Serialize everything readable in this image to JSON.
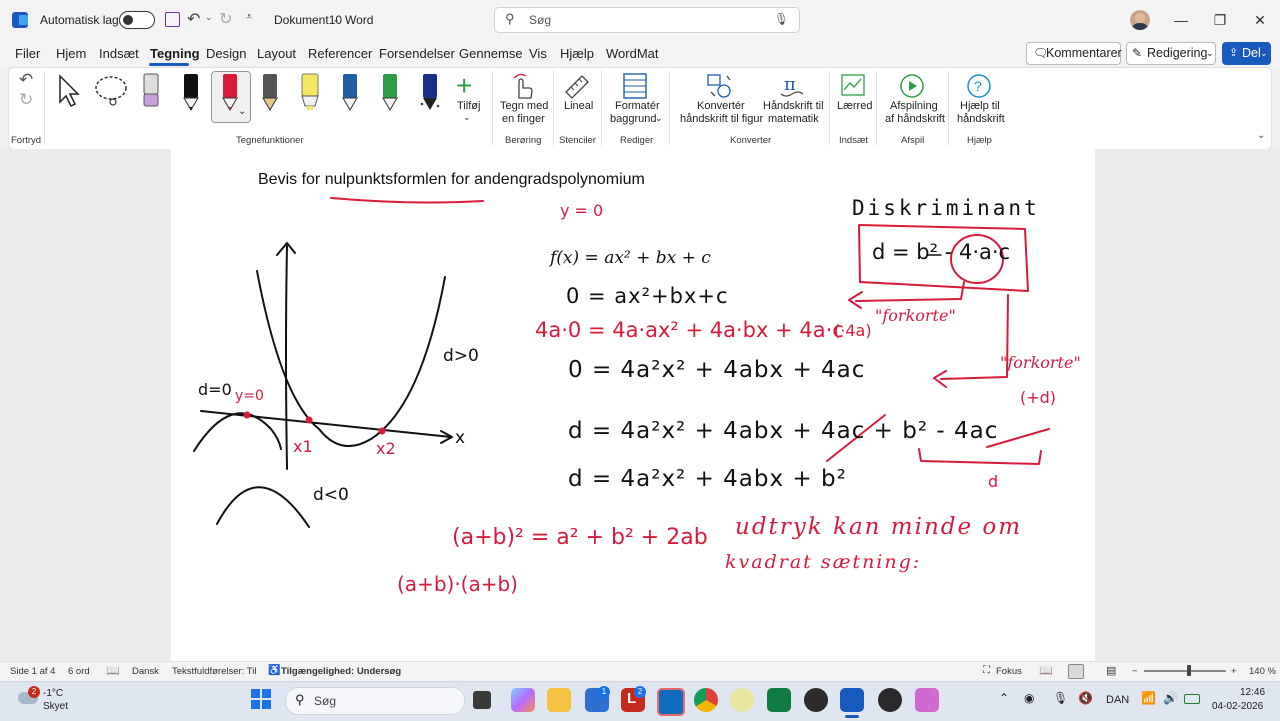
{
  "titlebar": {
    "autosave_label": "Automatisk lagring",
    "document_title": "Dokument10",
    "separator": "-",
    "app_name": "Word",
    "search_placeholder": "Søg"
  },
  "menu": {
    "tabs": [
      {
        "label": "Filer"
      },
      {
        "label": "Hjem"
      },
      {
        "label": "Indsæt"
      },
      {
        "label": "Tegning"
      },
      {
        "label": "Design"
      },
      {
        "label": "Layout"
      },
      {
        "label": "Referencer"
      },
      {
        "label": "Forsendelser"
      },
      {
        "label": "Gennemse"
      },
      {
        "label": "Vis"
      },
      {
        "label": "Hjælp"
      },
      {
        "label": "WordMat"
      }
    ],
    "active_tab": "Tegning",
    "comments_label": "Kommentarer",
    "editing_label": "Redigering",
    "share_label": "Del"
  },
  "ribbon": {
    "groups": {
      "undo": "Fortryd",
      "draw_tools": "Tegnefunktioner",
      "touch": "Berøring",
      "stencils": "Stenciler",
      "edit": "Rediger",
      "convert": "Konverter",
      "insert": "Indsæt",
      "replay": "Afspil",
      "help": "Hjælp"
    },
    "add_label": "Tilføj",
    "draw_finger": [
      "Tegn med",
      "en finger"
    ],
    "ruler": "Lineal",
    "format_bg": [
      "Formatér",
      "baggrund"
    ],
    "ink_to_shape": [
      "Konvertér",
      "håndskrift til figur"
    ],
    "ink_to_math": [
      "Håndskrift til",
      "matematik"
    ],
    "canvas": "Lærred",
    "ink_replay": [
      "Afspilning",
      "af håndskrift"
    ],
    "ink_help": [
      "Hjælp til",
      "håndskrift"
    ],
    "pen_colors": [
      "#111111",
      "#d81b3a",
      "#555555",
      "#f5e663",
      "#1f5fa8",
      "#2e9e46",
      "#1a2f8a"
    ]
  },
  "document": {
    "heading_prefix": "Bevis for ",
    "heading_underlined": "nulpunktsformlen",
    "heading_suffix": " for andengradspolynomium",
    "typed_formula": "f(x) = ax² + bx + c",
    "ink_black": {
      "eq1": "0 = ax²+bx+c",
      "eq2": "0 = 4a²x² + 4abx + 4ac",
      "eq3": "d = 4a²x² + 4abx + 4ac + b² - 4ac",
      "eq4": "d = 4a²x² + 4abx + b²",
      "discriminant_title": "Diskriminant",
      "discriminant_formula": "d = b² - 4·a·c",
      "graph_d_pos": "d>0",
      "graph_d_zero": "d=0",
      "graph_d_neg": "d<0",
      "axis_x": "x"
    },
    "ink_red": {
      "y0": "y = 0",
      "mult_line": "4a·0 = 4a·ax² + 4a·bx + 4a·c",
      "times4a": "(·4a)",
      "forkorte1": "\"forkorte\"",
      "forkorte2": "\"forkorte\"",
      "plus_d": "(+d)",
      "d_label": "d",
      "y0_graph": "y=0",
      "x1": "x1",
      "x2": "x2",
      "square": "(a+b)² = a² + b² + 2ab",
      "product": "(a+b)·(a+b)",
      "note1": "udtryk kan minde om",
      "note2": "kvadrat sætning:"
    }
  },
  "status": {
    "page": "Side 1 af 4",
    "words": "6 ord",
    "language": "Dansk",
    "predictions": "Tekstfuldførelser: Til",
    "accessibility": "Tilgængelighed: Undersøg",
    "focus": "Fokus",
    "zoom": "140 %"
  },
  "taskbar": {
    "weather_temp": "-1°C",
    "weather_desc": "Skyet",
    "weather_badge": "2",
    "search_placeholder": "Søg",
    "badge_store": "1",
    "badge_l": "2",
    "language": "DAN",
    "time": "12:46",
    "date": "04-02-2026"
  }
}
